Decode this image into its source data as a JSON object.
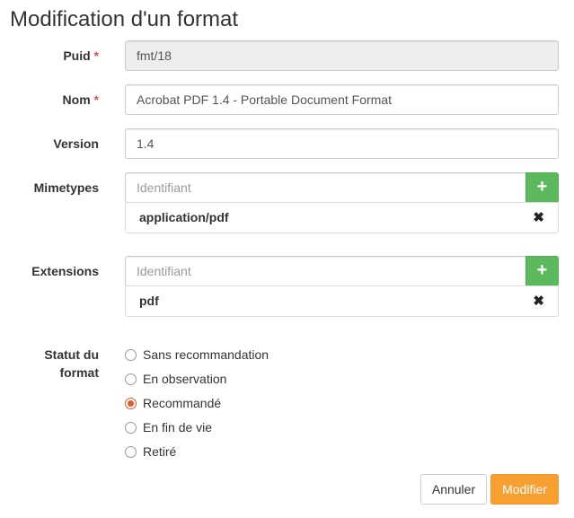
{
  "page": {
    "title": "Modification d'un format"
  },
  "form": {
    "puid": {
      "label": "Puid",
      "required": "*",
      "value": "fmt/18"
    },
    "nom": {
      "label": "Nom",
      "required": "*",
      "value": "Acrobat PDF 1.4 - Portable Document Format"
    },
    "version": {
      "label": "Version",
      "value": "1.4"
    },
    "mimetypes": {
      "label": "Mimetypes",
      "placeholder": "Identifiant",
      "add_icon": "+",
      "items": [
        {
          "value": "application/pdf",
          "remove_icon": "✖"
        }
      ]
    },
    "extensions": {
      "label": "Extensions",
      "placeholder": "Identifiant",
      "add_icon": "+",
      "items": [
        {
          "value": "pdf",
          "remove_icon": "✖"
        }
      ]
    },
    "statut": {
      "label_line1": "Statut du",
      "label_line2": "format",
      "options": [
        {
          "label": "Sans recommandation",
          "checked": false
        },
        {
          "label": "En observation",
          "checked": false
        },
        {
          "label": "Recommandé",
          "checked": true
        },
        {
          "label": "En fin de vie",
          "checked": false
        },
        {
          "label": "Retiré",
          "checked": false
        }
      ]
    }
  },
  "actions": {
    "cancel": "Annuler",
    "submit": "Modifier"
  },
  "colors": {
    "accent": "#f7a031",
    "add_button": "#5cb85c",
    "radio_checked": "#e05a2b",
    "required": "#d9534f"
  }
}
